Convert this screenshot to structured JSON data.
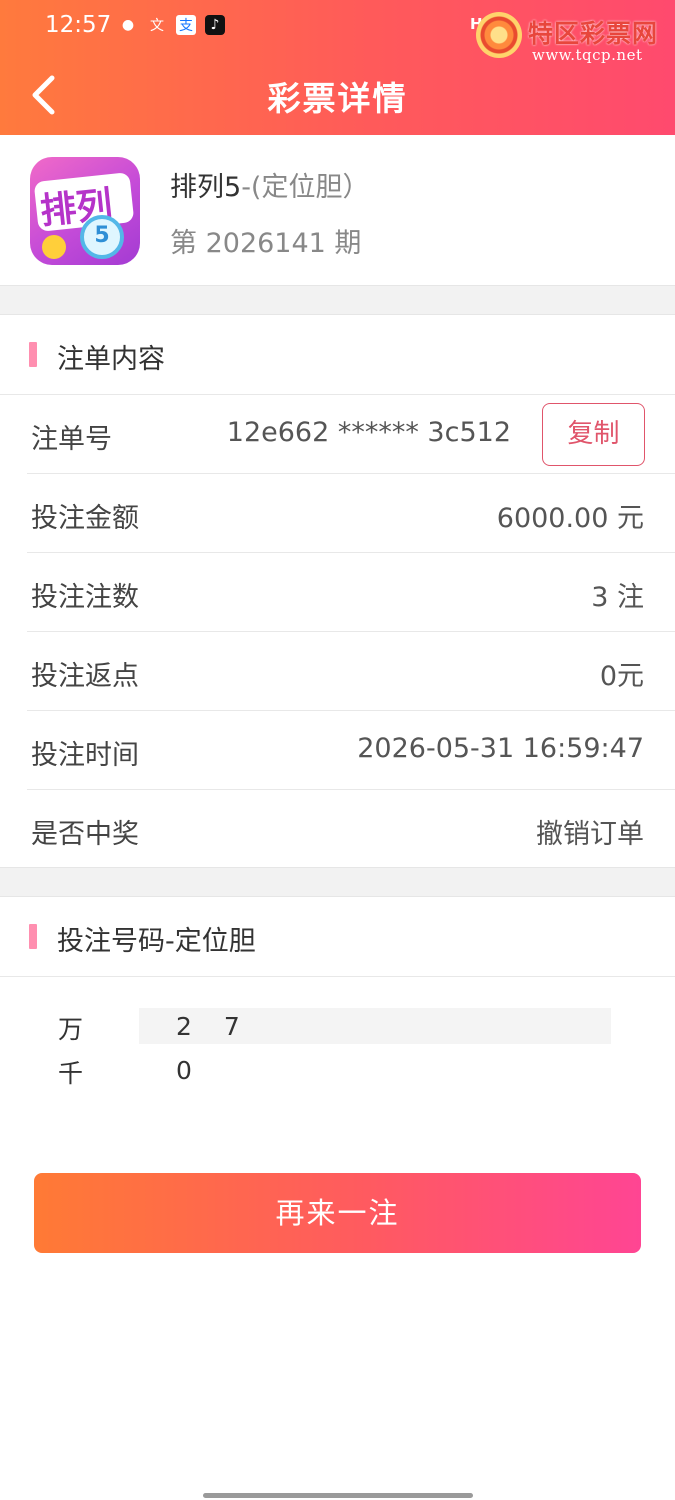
{
  "status_bar": {
    "time": "12:57",
    "network_text": "HD"
  },
  "watermark": {
    "title": "特区彩票网",
    "url": "www.tqcp.net"
  },
  "header": {
    "title": "彩票详情"
  },
  "lottery": {
    "icon_text": "排列",
    "icon_ball": "5",
    "name": "排列5",
    "play_type": "-(定位胆）",
    "issue": "第 2026141 期"
  },
  "bet_section": {
    "title": "注单内容",
    "rows": [
      {
        "label": "注单号",
        "value": "12e662 ****** 3c512"
      },
      {
        "label": "投注金额",
        "value": "6000.00 元"
      },
      {
        "label": "投注注数",
        "value": "3 注"
      },
      {
        "label": "投注返点",
        "value": "0元"
      },
      {
        "label": "投注时间",
        "value": "2026-05-31 16:59:47"
      },
      {
        "label": "是否中奖",
        "value": "撤销订单"
      }
    ],
    "copy_label": "复制"
  },
  "numbers_section": {
    "title": "投注号码-定位胆",
    "rows": [
      {
        "position": "万",
        "digits": [
          "2",
          "7"
        ]
      },
      {
        "position": "千",
        "digits": [
          "0"
        ]
      }
    ]
  },
  "actions": {
    "again_label": "再来一注"
  },
  "colors": {
    "header_start": "#ff7a3d",
    "header_end": "#ff4a6e",
    "accent": "#e0556b",
    "section_bar": "#ff8fb0"
  }
}
